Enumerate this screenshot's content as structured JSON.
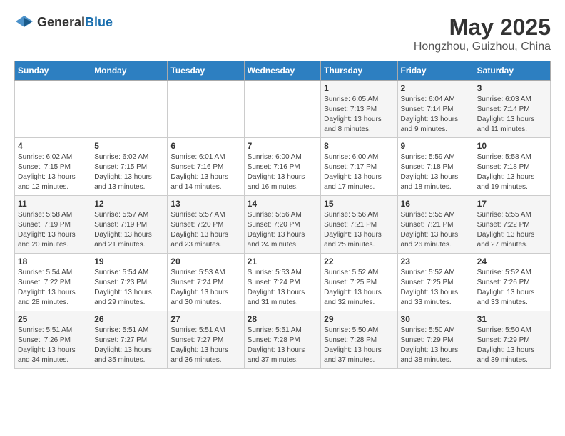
{
  "header": {
    "logo_general": "General",
    "logo_blue": "Blue",
    "month": "May 2025",
    "location": "Hongzhou, Guizhou, China"
  },
  "weekdays": [
    "Sunday",
    "Monday",
    "Tuesday",
    "Wednesday",
    "Thursday",
    "Friday",
    "Saturday"
  ],
  "weeks": [
    [
      {
        "day": "",
        "info": ""
      },
      {
        "day": "",
        "info": ""
      },
      {
        "day": "",
        "info": ""
      },
      {
        "day": "",
        "info": ""
      },
      {
        "day": "1",
        "info": "Sunrise: 6:05 AM\nSunset: 7:13 PM\nDaylight: 13 hours\nand 8 minutes."
      },
      {
        "day": "2",
        "info": "Sunrise: 6:04 AM\nSunset: 7:14 PM\nDaylight: 13 hours\nand 9 minutes."
      },
      {
        "day": "3",
        "info": "Sunrise: 6:03 AM\nSunset: 7:14 PM\nDaylight: 13 hours\nand 11 minutes."
      }
    ],
    [
      {
        "day": "4",
        "info": "Sunrise: 6:02 AM\nSunset: 7:15 PM\nDaylight: 13 hours\nand 12 minutes."
      },
      {
        "day": "5",
        "info": "Sunrise: 6:02 AM\nSunset: 7:15 PM\nDaylight: 13 hours\nand 13 minutes."
      },
      {
        "day": "6",
        "info": "Sunrise: 6:01 AM\nSunset: 7:16 PM\nDaylight: 13 hours\nand 14 minutes."
      },
      {
        "day": "7",
        "info": "Sunrise: 6:00 AM\nSunset: 7:16 PM\nDaylight: 13 hours\nand 16 minutes."
      },
      {
        "day": "8",
        "info": "Sunrise: 6:00 AM\nSunset: 7:17 PM\nDaylight: 13 hours\nand 17 minutes."
      },
      {
        "day": "9",
        "info": "Sunrise: 5:59 AM\nSunset: 7:18 PM\nDaylight: 13 hours\nand 18 minutes."
      },
      {
        "day": "10",
        "info": "Sunrise: 5:58 AM\nSunset: 7:18 PM\nDaylight: 13 hours\nand 19 minutes."
      }
    ],
    [
      {
        "day": "11",
        "info": "Sunrise: 5:58 AM\nSunset: 7:19 PM\nDaylight: 13 hours\nand 20 minutes."
      },
      {
        "day": "12",
        "info": "Sunrise: 5:57 AM\nSunset: 7:19 PM\nDaylight: 13 hours\nand 21 minutes."
      },
      {
        "day": "13",
        "info": "Sunrise: 5:57 AM\nSunset: 7:20 PM\nDaylight: 13 hours\nand 23 minutes."
      },
      {
        "day": "14",
        "info": "Sunrise: 5:56 AM\nSunset: 7:20 PM\nDaylight: 13 hours\nand 24 minutes."
      },
      {
        "day": "15",
        "info": "Sunrise: 5:56 AM\nSunset: 7:21 PM\nDaylight: 13 hours\nand 25 minutes."
      },
      {
        "day": "16",
        "info": "Sunrise: 5:55 AM\nSunset: 7:21 PM\nDaylight: 13 hours\nand 26 minutes."
      },
      {
        "day": "17",
        "info": "Sunrise: 5:55 AM\nSunset: 7:22 PM\nDaylight: 13 hours\nand 27 minutes."
      }
    ],
    [
      {
        "day": "18",
        "info": "Sunrise: 5:54 AM\nSunset: 7:22 PM\nDaylight: 13 hours\nand 28 minutes."
      },
      {
        "day": "19",
        "info": "Sunrise: 5:54 AM\nSunset: 7:23 PM\nDaylight: 13 hours\nand 29 minutes."
      },
      {
        "day": "20",
        "info": "Sunrise: 5:53 AM\nSunset: 7:24 PM\nDaylight: 13 hours\nand 30 minutes."
      },
      {
        "day": "21",
        "info": "Sunrise: 5:53 AM\nSunset: 7:24 PM\nDaylight: 13 hours\nand 31 minutes."
      },
      {
        "day": "22",
        "info": "Sunrise: 5:52 AM\nSunset: 7:25 PM\nDaylight: 13 hours\nand 32 minutes."
      },
      {
        "day": "23",
        "info": "Sunrise: 5:52 AM\nSunset: 7:25 PM\nDaylight: 13 hours\nand 33 minutes."
      },
      {
        "day": "24",
        "info": "Sunrise: 5:52 AM\nSunset: 7:26 PM\nDaylight: 13 hours\nand 33 minutes."
      }
    ],
    [
      {
        "day": "25",
        "info": "Sunrise: 5:51 AM\nSunset: 7:26 PM\nDaylight: 13 hours\nand 34 minutes."
      },
      {
        "day": "26",
        "info": "Sunrise: 5:51 AM\nSunset: 7:27 PM\nDaylight: 13 hours\nand 35 minutes."
      },
      {
        "day": "27",
        "info": "Sunrise: 5:51 AM\nSunset: 7:27 PM\nDaylight: 13 hours\nand 36 minutes."
      },
      {
        "day": "28",
        "info": "Sunrise: 5:51 AM\nSunset: 7:28 PM\nDaylight: 13 hours\nand 37 minutes."
      },
      {
        "day": "29",
        "info": "Sunrise: 5:50 AM\nSunset: 7:28 PM\nDaylight: 13 hours\nand 37 minutes."
      },
      {
        "day": "30",
        "info": "Sunrise: 5:50 AM\nSunset: 7:29 PM\nDaylight: 13 hours\nand 38 minutes."
      },
      {
        "day": "31",
        "info": "Sunrise: 5:50 AM\nSunset: 7:29 PM\nDaylight: 13 hours\nand 39 minutes."
      }
    ]
  ]
}
